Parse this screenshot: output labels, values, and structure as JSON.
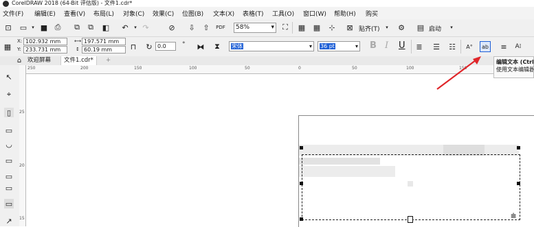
{
  "window": {
    "title": "CorelDRAW 2018 (64-Bit 评估版) - 文件1.cdr*"
  },
  "menu": [
    {
      "label": "文件(F)"
    },
    {
      "label": "编辑(E)"
    },
    {
      "label": "查看(V)"
    },
    {
      "label": "布局(L)"
    },
    {
      "label": "对象(C)"
    },
    {
      "label": "效果(C)"
    },
    {
      "label": "位图(B)"
    },
    {
      "label": "文本(X)"
    },
    {
      "label": "表格(T)"
    },
    {
      "label": "工具(O)"
    },
    {
      "label": "窗口(W)"
    },
    {
      "label": "帮助(H)"
    },
    {
      "label": "购买"
    }
  ],
  "standard_toolbar": {
    "zoom_value": "58%",
    "snap_label": "贴齐(T)",
    "launch_label": "启动"
  },
  "property_bar": {
    "x": "102.932 mm",
    "y": "233.731 mm",
    "width": "197.571 mm",
    "height": "60.19 mm",
    "rotation": "0.0",
    "font_name": "宋体",
    "font_size": "36 pt",
    "bold": "B",
    "italic": "I",
    "underline": "U"
  },
  "tabs": [
    {
      "label": "欢迎屏幕"
    },
    {
      "label": "文件1.cdr*"
    },
    {
      "label": "+"
    }
  ],
  "ruler_ticks": [
    "250",
    "200",
    "150",
    "100",
    "50",
    "0",
    "50",
    "100",
    "150"
  ],
  "vruler_ticks": [
    "25",
    "20",
    "15"
  ],
  "tooltip": {
    "title": "编辑文本 (Ctrl+Shift+T)",
    "desc": "使用文本编辑器"
  },
  "colors": {
    "accent": "#1e5fd6",
    "arrow": "#e0262a",
    "selection": "#111111"
  }
}
